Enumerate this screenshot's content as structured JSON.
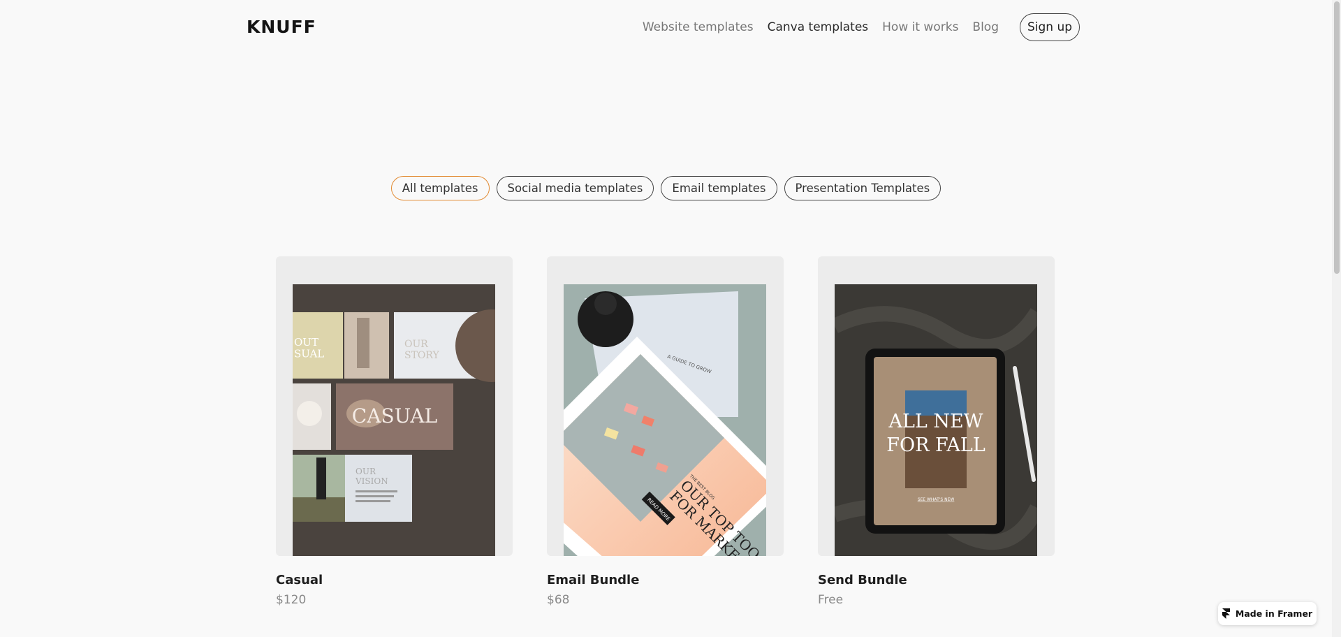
{
  "header": {
    "logo": "KNUFF",
    "nav": [
      {
        "label": "Website templates"
      },
      {
        "label": "Canva templates"
      },
      {
        "label": "How it works"
      },
      {
        "label": "Blog"
      }
    ],
    "signup_label": "Sign up"
  },
  "filters": {
    "selected": "All templates",
    "items": [
      {
        "label": "All templates"
      },
      {
        "label": "Social media templates"
      },
      {
        "label": "Email templates"
      },
      {
        "label": "Presentation Templates"
      }
    ]
  },
  "products": [
    {
      "name": "Casual",
      "price": "$120",
      "art": {
        "word": "CASUAL",
        "panel_a": "OUT\nSUAL",
        "panel_b": "OUR\nSTORY",
        "panel_c": "OUR\nVISION"
      }
    },
    {
      "name": "Email Bundle",
      "price": "$68",
      "art": {
        "kicker": "THE BEST BLOG",
        "headline": "OUR TOP TOO\nFOR MARKE",
        "cta": "READ MORE",
        "note": "A GUIDE TO GROW"
      }
    },
    {
      "name": "Send Bundle",
      "price": "Free",
      "art": {
        "headline": "ALL NEW\nFOR FALL",
        "link": "SEE WHAT'S NEW"
      }
    }
  ],
  "badge": {
    "label": "Made in Framer",
    "icon": "framer-icon"
  },
  "colors": {
    "background": "#f9f9f9",
    "accent": "#e28b33"
  }
}
